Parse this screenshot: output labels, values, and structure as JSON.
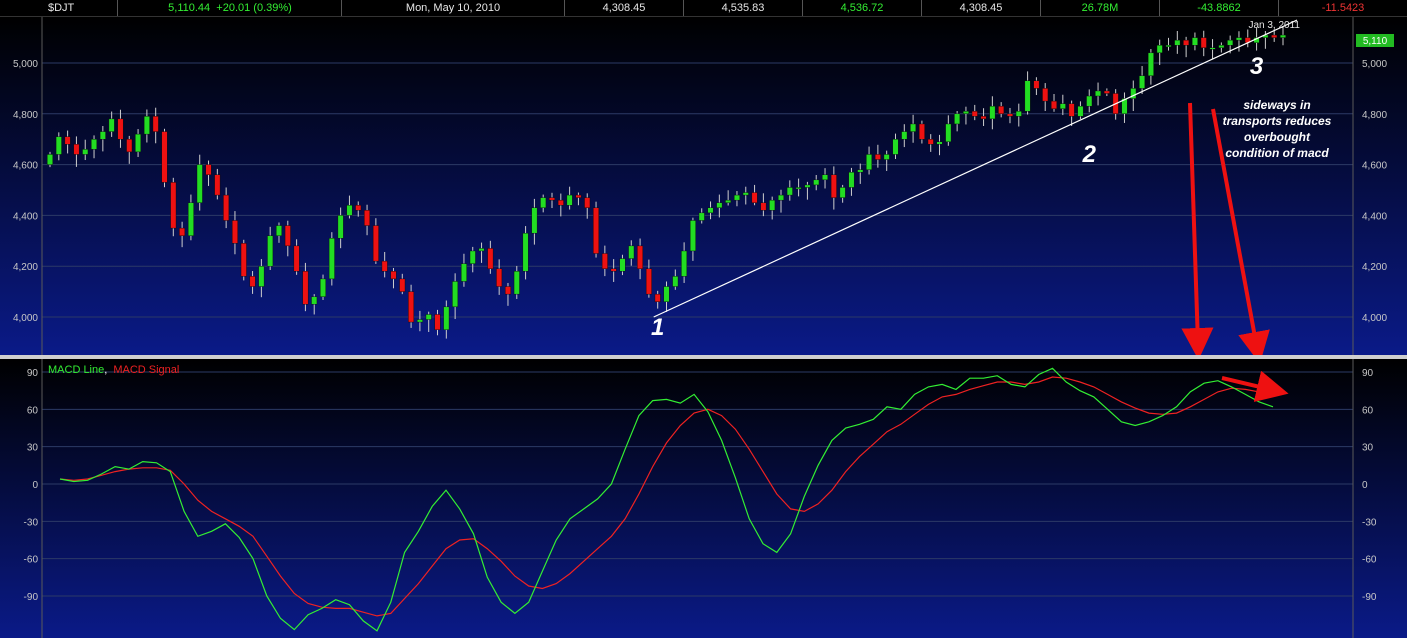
{
  "header": {
    "symbol": "$DJT",
    "last": "5,110.44",
    "change": "+20.01 (0.39%)",
    "date": "Mon, May 10, 2010",
    "open": "4,308.45",
    "high": "4,535.83",
    "high_colored": "4,536.72",
    "low": "4,308.45",
    "volume": "26.78M",
    "value_neg1": "-43.8862",
    "value_neg2": "-11.5423"
  },
  "colors": {
    "up_candle": "#22dd22",
    "down_candle": "#ee1111",
    "macd_line": "#33ee33",
    "macd_signal": "#ee2222",
    "trendline": "#ffffff",
    "arrow": "#ee1111",
    "separator": "#cfcfcf"
  },
  "chart_data": [
    {
      "type": "candlestick",
      "title": "$DJT",
      "date_label": "Jan 3, 2011",
      "last_price_label": "5,110",
      "ylim": [
        3850,
        5130
      ],
      "y_ticks": [
        4000,
        4200,
        4400,
        4600,
        4800,
        5000
      ],
      "y_tick_labels": [
        "4,000",
        "4,200",
        "4,400",
        "4,600",
        "4,800",
        "5,000"
      ],
      "closes": [
        4640,
        4710,
        4680,
        4640,
        4660,
        4700,
        4730,
        4780,
        4700,
        4650,
        4720,
        4790,
        4730,
        4530,
        4350,
        4320,
        4450,
        4600,
        4560,
        4480,
        4380,
        4290,
        4160,
        4120,
        4200,
        4320,
        4360,
        4280,
        4180,
        4050,
        4080,
        4150,
        4310,
        4400,
        4440,
        4420,
        4360,
        4220,
        4180,
        4150,
        4100,
        3980,
        3990,
        4010,
        3950,
        4040,
        4140,
        4210,
        4260,
        4270,
        4190,
        4120,
        4090,
        4180,
        4330,
        4430,
        4470,
        4460,
        4440,
        4480,
        4470,
        4430,
        4250,
        4190,
        4180,
        4230,
        4280,
        4190,
        4090,
        4060,
        4120,
        4160,
        4260,
        4380,
        4410,
        4430,
        4450,
        4460,
        4480,
        4490,
        4450,
        4420,
        4460,
        4480,
        4510,
        4510,
        4520,
        4540,
        4560,
        4470,
        4510,
        4570,
        4580,
        4640,
        4620,
        4640,
        4700,
        4730,
        4760,
        4700,
        4680,
        4690,
        4760,
        4800,
        4810,
        4790,
        4780,
        4830,
        4800,
        4790,
        4810,
        4930,
        4900,
        4850,
        4820,
        4840,
        4790,
        4830,
        4870,
        4890,
        4880,
        4800,
        4860,
        4900,
        4950,
        5040,
        5070,
        5070,
        5090,
        5070,
        5100,
        5060,
        5060,
        5070,
        5090,
        5100,
        5080,
        5100,
        5110,
        5100,
        5110
      ],
      "annotations": [
        {
          "text": "1",
          "date_index": 69,
          "value": 4000
        },
        {
          "text": "2",
          "date_index": 118,
          "value": 4650
        },
        {
          "text": "3",
          "date_index": 137,
          "value": 4980
        },
        {
          "text": "sideways in transports reduces overbought condition of macd",
          "lines": [
            "sideways in",
            "transports reduces",
            "overbought",
            "condition of macd"
          ]
        }
      ]
    },
    {
      "type": "line",
      "title": "MACD",
      "ylim": [
        -118,
        100
      ],
      "y_ticks": [
        -90,
        -60,
        -30,
        0,
        30,
        60,
        90
      ],
      "y_tick_labels": [
        "-90",
        "-60",
        "-30",
        "0",
        "30",
        "60",
        "90"
      ],
      "series": [
        {
          "name": "MACD Line",
          "separator_after": ",",
          "values": [
            4,
            2,
            3,
            8,
            14,
            12,
            18,
            17,
            10,
            -22,
            -42,
            -38,
            -32,
            -43,
            -60,
            -90,
            -108,
            -117,
            -105,
            -100,
            -93,
            -97,
            -110,
            -118,
            -95,
            -55,
            -38,
            -18,
            -5,
            -20,
            -40,
            -75,
            -95,
            -104,
            -95,
            -70,
            -45,
            -28,
            -20,
            -12,
            0,
            28,
            55,
            67,
            68,
            65,
            72,
            58,
            35,
            5,
            -28,
            -48,
            -55,
            -40,
            -10,
            15,
            35,
            45,
            48,
            52,
            62,
            60,
            72,
            78,
            80,
            76,
            85,
            85,
            87,
            80,
            78,
            88,
            93,
            82,
            75,
            70,
            60,
            50,
            47,
            50,
            55,
            62,
            74,
            81,
            83,
            78,
            72,
            66,
            62
          ]
        },
        {
          "name": "MACD Signal",
          "values": [
            4,
            3,
            4,
            7,
            10,
            12,
            13,
            13,
            11,
            0,
            -13,
            -22,
            -28,
            -34,
            -42,
            -58,
            -74,
            -88,
            -96,
            -99,
            -100,
            -100,
            -103,
            -106,
            -104,
            -92,
            -80,
            -66,
            -52,
            -45,
            -44,
            -52,
            -62,
            -74,
            -82,
            -84,
            -80,
            -72,
            -62,
            -52,
            -42,
            -28,
            -8,
            14,
            33,
            47,
            57,
            60,
            55,
            44,
            28,
            10,
            -8,
            -20,
            -22,
            -16,
            -5,
            10,
            22,
            32,
            42,
            48,
            56,
            64,
            70,
            72,
            76,
            79,
            82,
            82,
            80,
            82,
            86,
            85,
            82,
            78,
            72,
            66,
            61,
            57,
            56,
            57,
            62,
            68,
            74,
            77,
            76,
            74,
            71
          ]
        }
      ]
    }
  ]
}
